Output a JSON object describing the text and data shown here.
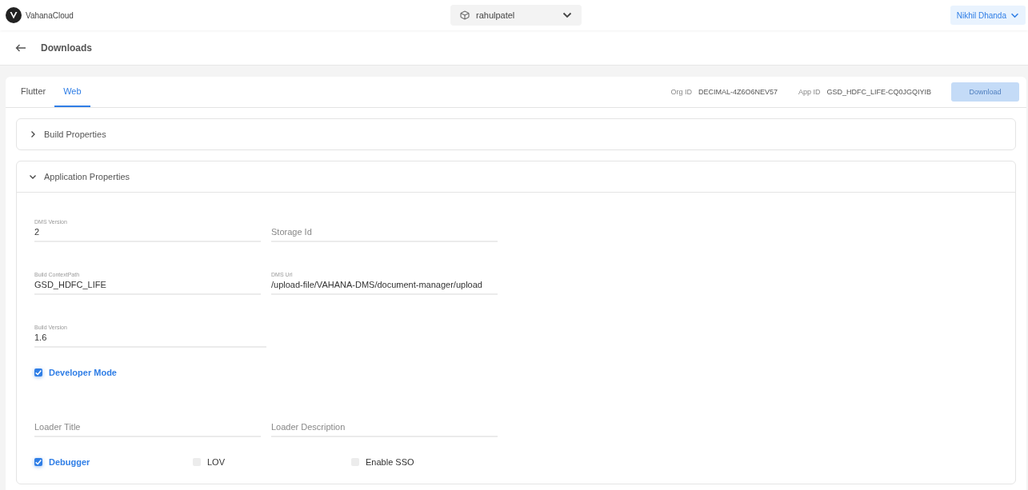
{
  "header": {
    "brand": "VahanaCloud",
    "workspace": "rahulpatel",
    "user": "Nikhil Dhanda"
  },
  "page": {
    "title": "Downloads"
  },
  "tabs": [
    {
      "label": "Flutter",
      "selected": false
    },
    {
      "label": "Web",
      "selected": true
    }
  ],
  "ids": [
    {
      "label": "Org ID",
      "value": "DECIMAL-4Z6O6NEV57"
    },
    {
      "label": "App ID",
      "value": "GSD_HDFC_LIFE-CQ0JGQIYIB"
    }
  ],
  "download_button": {
    "label": "Download",
    "disabled": true
  },
  "sections": [
    {
      "title": "Build Properties",
      "expanded": false
    },
    {
      "title": "Application Properties",
      "expanded": true
    }
  ],
  "field_rows": [
    [
      {
        "label": "DMS Version",
        "value": "2"
      },
      {
        "placeholder": "Storage Id"
      }
    ],
    [
      {
        "label": "Build ContextPath",
        "value": "GSD_HDFC_LIFE"
      },
      {
        "label": "DMS Url",
        "value": "/upload-file/VAHANA-DMS/document-manager/upload"
      }
    ],
    [
      {
        "label": "Build Version",
        "value": "1.6"
      }
    ]
  ],
  "developer_mode": {
    "label": "Developer Mode",
    "checked": true
  },
  "loader_fields": [
    {
      "placeholder": "Loader Title"
    },
    {
      "placeholder": "Loader Description"
    }
  ],
  "options": [
    {
      "label": "Debugger",
      "checked": true
    },
    {
      "label": "LOV",
      "checked": false
    },
    {
      "label": "Enable SSO",
      "checked": false
    }
  ]
}
